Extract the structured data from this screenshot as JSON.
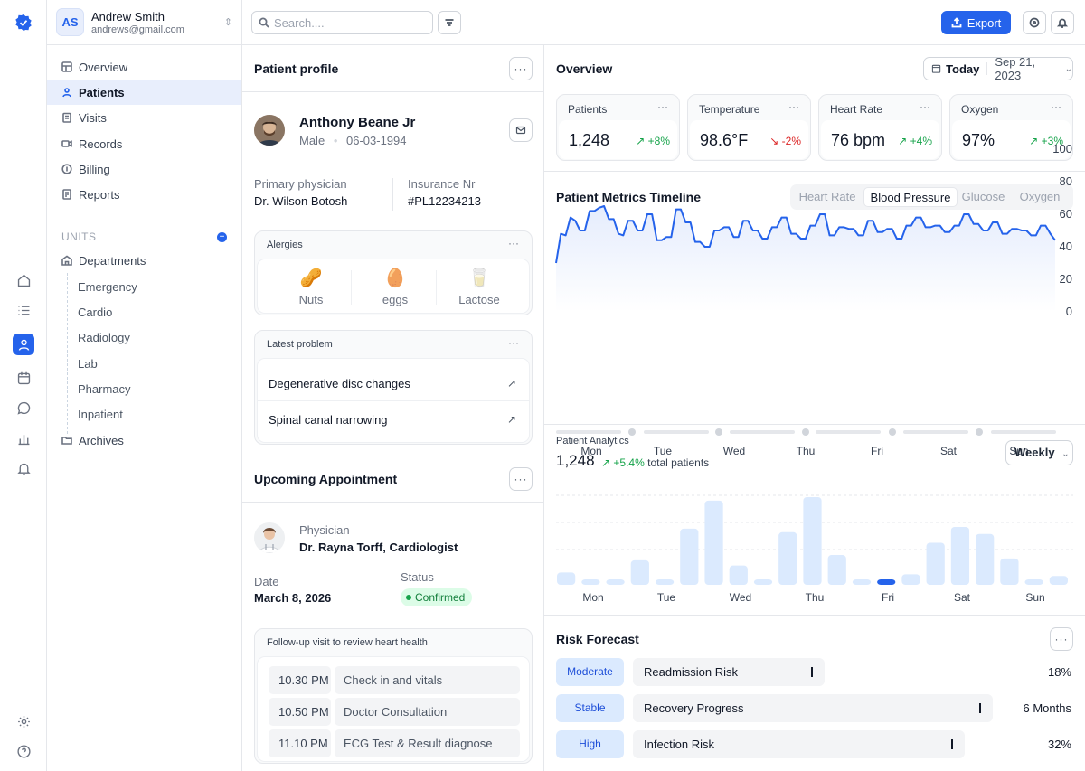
{
  "user": {
    "initials": "AS",
    "name": "Andrew Smith",
    "email": "andrews@gmail.com"
  },
  "search": {
    "placeholder": "Search...."
  },
  "toolbar": {
    "export_label": "Export"
  },
  "nav": {
    "items": [
      "Overview",
      "Patients",
      "Visits",
      "Records",
      "Billing",
      "Reports"
    ],
    "active": "Patients",
    "units_label": "UNITS",
    "departments": "Departments",
    "subitems": [
      "Emergency",
      "Cardio",
      "Radiology",
      "Lab",
      "Pharmacy",
      "Inpatient"
    ],
    "archives": "Archives"
  },
  "profile": {
    "title": "Patient profile",
    "name": "Anthony Beane Jr",
    "gender": "Male",
    "dob": "06-03-1994",
    "physician_label": "Primary physician",
    "physician": "Dr. Wilson Botosh",
    "insurance_label": "Insurance Nr",
    "insurance": "#PL12234213",
    "allergies_title": "Alergies",
    "allergies": [
      {
        "label": "Nuts",
        "icon": "🥜"
      },
      {
        "label": "eggs",
        "icon": "🥚"
      },
      {
        "label": "Lactose",
        "icon": "🥛"
      }
    ],
    "problem_title": "Latest problem",
    "problems": [
      "Degenerative disc changes",
      "Spinal canal narrowing"
    ]
  },
  "appointment": {
    "title": "Upcoming Appointment",
    "physician_label": "Physician",
    "physician": "Dr. Rayna Torff, Cardiologist",
    "date_label": "Date",
    "date": "March 8, 2026",
    "status_label": "Status",
    "status": "Confirmed",
    "visit_title": "Follow-up visit to review heart health",
    "schedule": [
      {
        "time": "10.30 PM",
        "desc": "Check in and vitals"
      },
      {
        "time": "10.50 PM",
        "desc": "Doctor Consultation"
      },
      {
        "time": "11.10  PM",
        "desc": "ECG Test & Result diagnose"
      }
    ]
  },
  "overview": {
    "title": "Overview",
    "today_label": "Today",
    "date": "Sep 21, 2023",
    "kpis": [
      {
        "label": "Patients",
        "value": "1,248",
        "change": "+8%",
        "dir": "up"
      },
      {
        "label": "Temperature",
        "value": "98.6°F",
        "change": "-2%",
        "dir": "down"
      },
      {
        "label": "Heart Rate",
        "value": "76 bpm",
        "change": "+4%",
        "dir": "up"
      },
      {
        "label": "Oxygen",
        "value": "97%",
        "change": "+3%",
        "dir": "up"
      }
    ]
  },
  "timeline": {
    "title": "Patient Metrics Timeline",
    "tabs": [
      "Heart Rate",
      "Blood Pressure",
      "Glucose",
      "Oxygen"
    ],
    "active_tab": "Blood Pressure"
  },
  "analytics": {
    "title": "Patient Analytics",
    "value": "1,248",
    "change": "+5.4%",
    "change_suffix": "total patients",
    "period": "Weekly"
  },
  "risk": {
    "title": "Risk Forecast",
    "rows": [
      {
        "tag": "Moderate",
        "label": "Readmission Risk",
        "value": "18%",
        "fill": 0.18
      },
      {
        "tag": "Stable",
        "label": "Recovery Progress",
        "value": "6 Months",
        "fill": 0.5
      },
      {
        "tag": "High",
        "label": "Infection Risk",
        "value": "32%",
        "fill": 0.32
      }
    ]
  },
  "chart_data": [
    {
      "type": "line",
      "title": "Patient Metrics Timeline",
      "categories": [
        "Mon",
        "Tue",
        "Wed",
        "Thu",
        "Fri",
        "Sat",
        "Sun"
      ],
      "yticks": [
        "100",
        "80",
        "60",
        "40",
        "20",
        "0"
      ],
      "ylim": [
        0,
        100
      ],
      "series": [
        {
          "values": [
            30,
            48,
            47,
            58,
            56,
            50,
            50,
            62,
            62,
            64,
            65,
            57,
            57,
            48,
            47,
            56,
            56,
            50,
            50,
            60,
            60,
            44,
            44,
            46,
            46,
            63,
            63,
            55,
            55,
            43,
            43,
            40,
            40,
            50,
            50,
            52,
            52,
            46,
            46,
            56,
            56,
            50,
            50,
            45,
            45,
            52,
            52,
            58,
            58,
            48,
            48,
            45,
            45,
            53,
            53,
            60,
            60,
            47,
            47,
            52,
            52,
            51,
            51,
            47,
            47,
            56,
            56,
            49,
            49,
            51,
            51,
            45,
            45,
            53,
            53,
            58,
            58,
            52,
            52,
            53,
            53,
            49,
            49,
            53,
            53,
            60,
            60,
            54,
            54,
            50,
            50,
            55,
            55,
            48,
            48,
            51,
            51,
            50,
            50,
            47,
            47,
            53,
            53,
            48,
            44
          ]
        }
      ]
    },
    {
      "type": "bar",
      "title": "Patient Analytics",
      "categories": [
        "Mon",
        "Tue",
        "Wed",
        "Thu",
        "Fri",
        "Sat",
        "Sun"
      ],
      "highlight": 13,
      "values": [
        14,
        6,
        6,
        28,
        6,
        64,
        96,
        22,
        6,
        60,
        100,
        34,
        6,
        6,
        12,
        48,
        66,
        58,
        30,
        6,
        10
      ]
    }
  ],
  "colors": {
    "accent": "#2563eb",
    "bar_light": "#dbeafe",
    "positive": "#16a34a",
    "negative": "#dc2626"
  }
}
